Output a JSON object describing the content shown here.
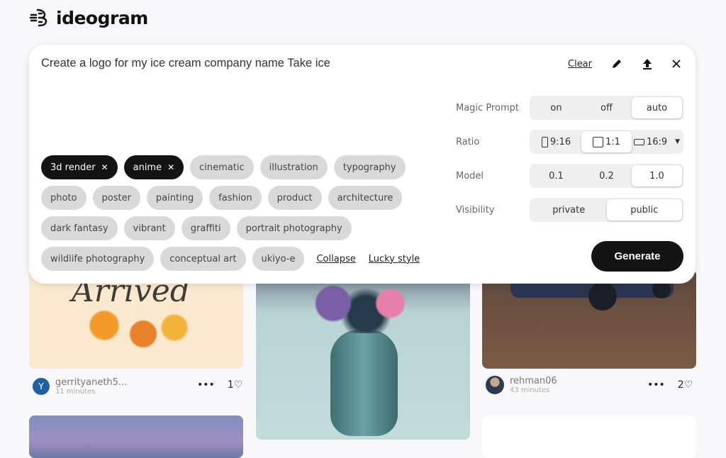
{
  "brand": {
    "name": "ideogram"
  },
  "prompt": {
    "value": "Create a logo for my ice cream company name Take ice",
    "clear_label": "Clear"
  },
  "tags": [
    {
      "label": "3d render",
      "selected": true
    },
    {
      "label": "anime",
      "selected": true
    },
    {
      "label": "cinematic"
    },
    {
      "label": "illustration"
    },
    {
      "label": "typography"
    },
    {
      "label": "photo"
    },
    {
      "label": "poster"
    },
    {
      "label": "painting"
    },
    {
      "label": "fashion"
    },
    {
      "label": "product"
    },
    {
      "label": "architecture"
    },
    {
      "label": "dark fantasy"
    },
    {
      "label": "vibrant"
    },
    {
      "label": "graffiti"
    },
    {
      "label": "portrait photography"
    },
    {
      "label": "wildlife photography"
    },
    {
      "label": "conceptual art"
    },
    {
      "label": "ukiyo-e"
    }
  ],
  "tag_links": {
    "collapse": "Collapse",
    "lucky": "Lucky style"
  },
  "settings": {
    "magic_prompt": {
      "label": "Magic Prompt",
      "options": [
        "on",
        "off",
        "auto"
      ],
      "selected": "auto"
    },
    "ratio": {
      "label": "Ratio",
      "options": [
        "9:16",
        "1:1",
        "16:9"
      ],
      "selected": "1:1"
    },
    "model": {
      "label": "Model",
      "options": [
        "0.1",
        "0.2",
        "1.0"
      ],
      "selected": "1.0"
    },
    "visibility": {
      "label": "Visibility",
      "options": [
        "private",
        "public"
      ],
      "selected": "public"
    }
  },
  "generate_label": "Generate",
  "posts": [
    {
      "user": "gerrityaneth5...",
      "time": "11 minutes",
      "likes": "1",
      "avatar_letter": "Y",
      "image_text": "Arrived"
    },
    {
      "user": "rehman06",
      "time": "43 minutes",
      "likes": "2"
    }
  ],
  "colors": {
    "accent": "#141414",
    "tag_bg": "#d9d9d9",
    "avatar": "#1f5fa8"
  }
}
